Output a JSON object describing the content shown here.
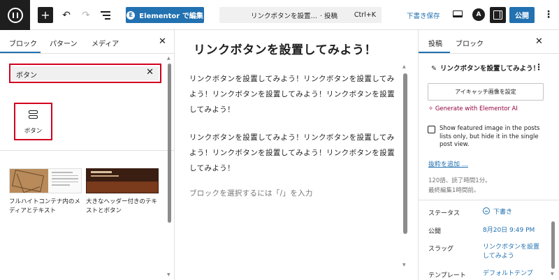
{
  "topbar": {
    "add_label": "+",
    "undo_label": "↶",
    "redo_label": "↷",
    "elementor_logo": "E",
    "elementor_label": "Elementor で編集",
    "doc_title": "リンクボタンを設置し...",
    "doc_type": "· 投稿",
    "doc_shortcut": "Ctrl+K",
    "save_draft": "下書き保存",
    "astra_label": "A",
    "publish": "公開",
    "more": "⋮"
  },
  "inserter": {
    "tabs": [
      "ブロック",
      "パターン",
      "メディア"
    ],
    "close": "✕",
    "search_value": "ボタン",
    "clear": "✕",
    "block_label": "ボタン",
    "patterns": [
      {
        "label": "フルハイトコンテナ内のメディアとテキスト"
      },
      {
        "label": "大きなヘッダー付きのテキストとボタン"
      }
    ]
  },
  "editor": {
    "title": "リンクボタンを設置してみよう！",
    "paragraphs": [
      "リンクボタンを設置してみよう！リンクボタンを設置してみよう！リンクボタンを設置してみよう！リンクボタンを設置してみよう！",
      "リンクボタンを設置してみよう！リンクボタンを設置してみよう！リンクボタンを設置してみよう！リンクボタンを設置してみよう！"
    ],
    "placeholder": "ブロックを選択するには「/」を入力"
  },
  "sidebar": {
    "tabs": [
      "投稿",
      "ブロック"
    ],
    "close": "✕",
    "pen": "✎",
    "post_title": "リンクボタンを設置してみよう！",
    "more": "⋮",
    "featured_image_btn": "アイキャッチ画像を設定",
    "gen_ai": "✧ Generate with Elementor AI",
    "checkbox_label": "Show featured image in the posts lists only, but hide it in the single post view.",
    "excerpt_link": "抜粋を追加 …",
    "meta_line1": "120語、読了時間1分。",
    "meta_line2": "最終編集1時間前。",
    "rows": [
      {
        "label": "ステータス",
        "value": "下書き"
      },
      {
        "label": "公開",
        "value": "8月20日 9:49 PM"
      },
      {
        "label": "スラッグ",
        "value": "リンクボタンを設置してみよう"
      },
      {
        "label": "テンプレート",
        "value": "デフォルトテンプ"
      }
    ]
  },
  "colors": {
    "accent": "#2271b1",
    "highlight": "#d1001f",
    "ai": "#93003c"
  }
}
